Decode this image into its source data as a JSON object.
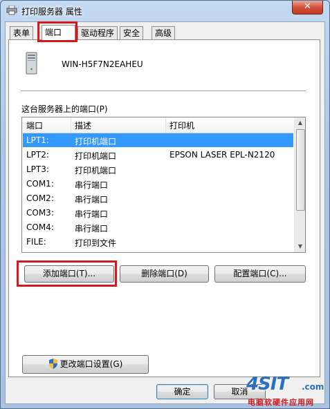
{
  "window": {
    "title": "打印服务器 属性",
    "close_label": "✕"
  },
  "tabs": [
    {
      "label": "表单",
      "active": false
    },
    {
      "label": "端口",
      "active": true
    },
    {
      "label": "驱动程序",
      "active": false
    },
    {
      "label": "安全",
      "active": false
    },
    {
      "label": "高级",
      "active": false
    }
  ],
  "server": {
    "name": "WIN-H5F7N2EAHEU",
    "icon": "server-computer-icon"
  },
  "ports_section": {
    "label": "这台服务器上的端口(P)",
    "columns": [
      "端口",
      "描述",
      "打印机"
    ],
    "rows": [
      {
        "port": "LPT1:",
        "description": "打印机端口",
        "printer": "",
        "selected": true
      },
      {
        "port": "LPT2:",
        "description": "打印机端口",
        "printer": "EPSON LASER EPL-N2120",
        "selected": false
      },
      {
        "port": "LPT3:",
        "description": "打印机端口",
        "printer": "",
        "selected": false
      },
      {
        "port": "COM1:",
        "description": "串行端口",
        "printer": "",
        "selected": false
      },
      {
        "port": "COM2:",
        "description": "串行端口",
        "printer": "",
        "selected": false
      },
      {
        "port": "COM3:",
        "description": "串行端口",
        "printer": "",
        "selected": false
      },
      {
        "port": "COM4:",
        "description": "串行端口",
        "printer": "",
        "selected": false
      },
      {
        "port": "FILE:",
        "description": "打印到文件",
        "printer": "",
        "selected": false
      }
    ]
  },
  "buttons": {
    "add_port": "添加端口(T)...",
    "delete_port": "删除端口(D)",
    "configure_port": "配置端口(C)...",
    "change_port_settings": "更改端口设置(G)",
    "ok": "确定",
    "cancel": "取消"
  },
  "watermark": {
    "logo": "4SIT",
    "domain": ".com",
    "subtitle": "电脑软硬件应用网"
  },
  "colors": {
    "selection": "#3399ff",
    "highlight_box": "#d7181c",
    "title_bar": "#b9d1ea"
  }
}
